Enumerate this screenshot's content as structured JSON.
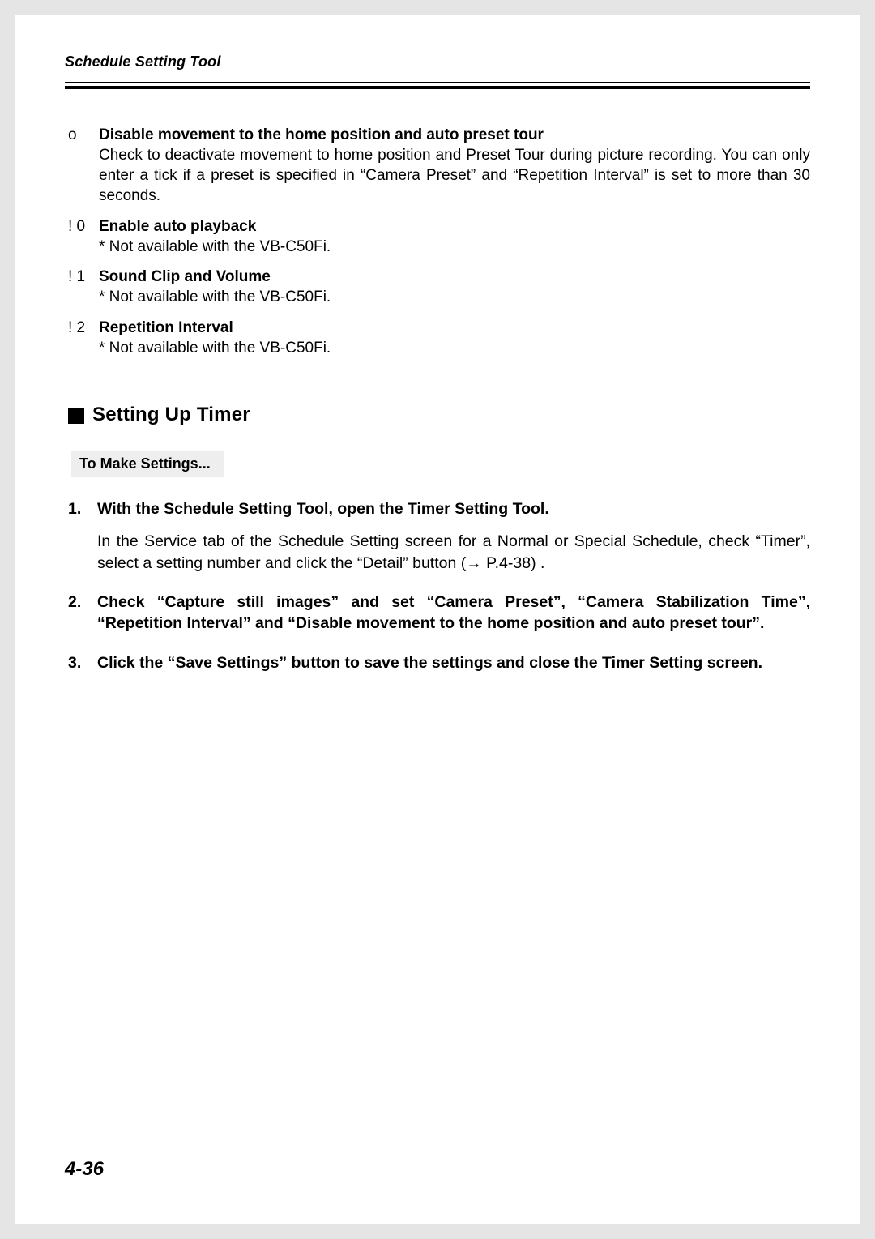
{
  "running_head": "Schedule Setting Tool",
  "items": [
    {
      "mark": "o",
      "title": "Disable movement to the home position and auto preset tour",
      "desc": "Check to deactivate movement to home position and Preset Tour during picture recording. You can only enter a tick if a preset is specified in “Camera Preset” and “Repetition Interval” is set to more than 30 seconds.",
      "note": ""
    },
    {
      "mark": "! 0",
      "title": "Enable auto playback",
      "desc": "",
      "note": "* Not available with the VB-C50Fi."
    },
    {
      "mark": "! 1",
      "title": "Sound Clip and Volume",
      "desc": "",
      "note": "* Not available with the VB-C50Fi."
    },
    {
      "mark": "! 2",
      "title": "Repetition Interval",
      "desc": "",
      "note": "* Not available with the VB-C50Fi."
    }
  ],
  "section": {
    "title": "Setting Up Timer",
    "subhead": "To Make Settings..."
  },
  "steps": [
    {
      "num": "1.",
      "title": "With the Schedule Setting Tool, open the Timer Setting Tool.",
      "desc": "In the Service tab of the Schedule Setting screen for a Normal or Special Schedule, check “Timer”, select a setting number and click the “Detail” button (→ P.4-38) ."
    },
    {
      "num": "2.",
      "title": "Check “Capture still images” and set “Camera Preset”, “Camera Stabilization Time”, “Repetition Interval” and “Disable movement to the home position and auto preset tour”.",
      "desc": ""
    },
    {
      "num": "3.",
      "title": "Click the “Save Settings” button to save the settings and close the Timer Setting screen.",
      "desc": ""
    }
  ],
  "page_number": "4-36"
}
